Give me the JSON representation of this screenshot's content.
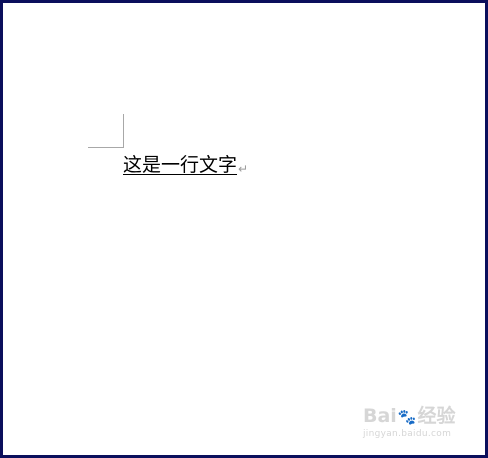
{
  "document": {
    "line_text": "这是一行文字",
    "paragraph_mark": "↵"
  },
  "colors": {
    "frame_border": "#0b0f5c",
    "page_background": "#ffffff",
    "text": "#000000",
    "margin_mark": "#a8a8a8"
  },
  "watermark": {
    "logo_left": "Bai",
    "logo_paw": "🐾",
    "logo_right": "经验",
    "url": "jingyan.baidu.com"
  }
}
